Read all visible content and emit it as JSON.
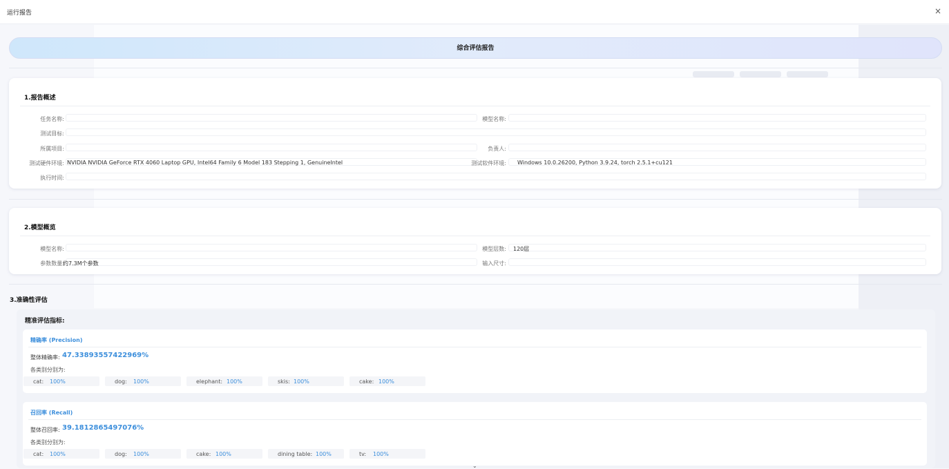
{
  "window": {
    "title": "运行报告",
    "close_glyph": "×"
  },
  "header": {
    "title": "综合评估报告"
  },
  "overview": {
    "heading": "1.报告概述",
    "task_name_label": "任务名称:",
    "model_name_label": "模型名称:",
    "test_target_label": "测试目标:",
    "project_label": "所属项目:",
    "owner_label": "负责人:",
    "hardware_label": "测试硬件环境:",
    "hardware_value": "NVIDIA NVIDIA GeForce RTX 4060 Laptop GPU, Intel64 Family 6 Model 183 Stepping 1, GenuineIntel",
    "software_label": "测试软件环境:",
    "software_value": "Windows 10.0.26200, Python 3.9.24, torch 2.5.1+cu121",
    "exec_time_label": "执行时间:"
  },
  "model": {
    "heading": "2.模型概览",
    "name_label": "模型名称:",
    "layers_label": "模型层数:",
    "layers_value": "120层",
    "params_label": "参数数量:",
    "params_value": "约7.3M个参数",
    "input_size_label": "输入尺寸:"
  },
  "accuracy": {
    "heading": "3.准确性评估",
    "subheading": "精准评估指标:",
    "precision": {
      "name": "精确率 (Precision)",
      "overall_label": "整体精确率:",
      "overall_value": "47.33893557422969%",
      "per_class_label": "各类别分别为:",
      "classes": [
        {
          "name": "cat:",
          "value": "100%"
        },
        {
          "name": "dog:",
          "value": "100%"
        },
        {
          "name": "elephant:",
          "value": "100%"
        },
        {
          "name": "skis:",
          "value": "100%"
        },
        {
          "name": "cake:",
          "value": "100%"
        }
      ]
    },
    "recall": {
      "name": "召回率 (Recall)",
      "overall_label": "整体召回率:",
      "overall_value": "39.1812865497076%",
      "per_class_label": "各类别分别为:",
      "classes": [
        {
          "name": "cat:",
          "value": "100%"
        },
        {
          "name": "dog:",
          "value": "100%"
        },
        {
          "name": "cake:",
          "value": "100%"
        },
        {
          "name": "dining table:",
          "value": "100%"
        },
        {
          "name": "tv:",
          "value": "100%"
        }
      ]
    }
  },
  "scroll_glyph": "⌄",
  "colors": {
    "accent": "#3d8fdc",
    "header_gradient_start": "#cfe7fb",
    "header_gradient_end": "#e0e4fb"
  }
}
